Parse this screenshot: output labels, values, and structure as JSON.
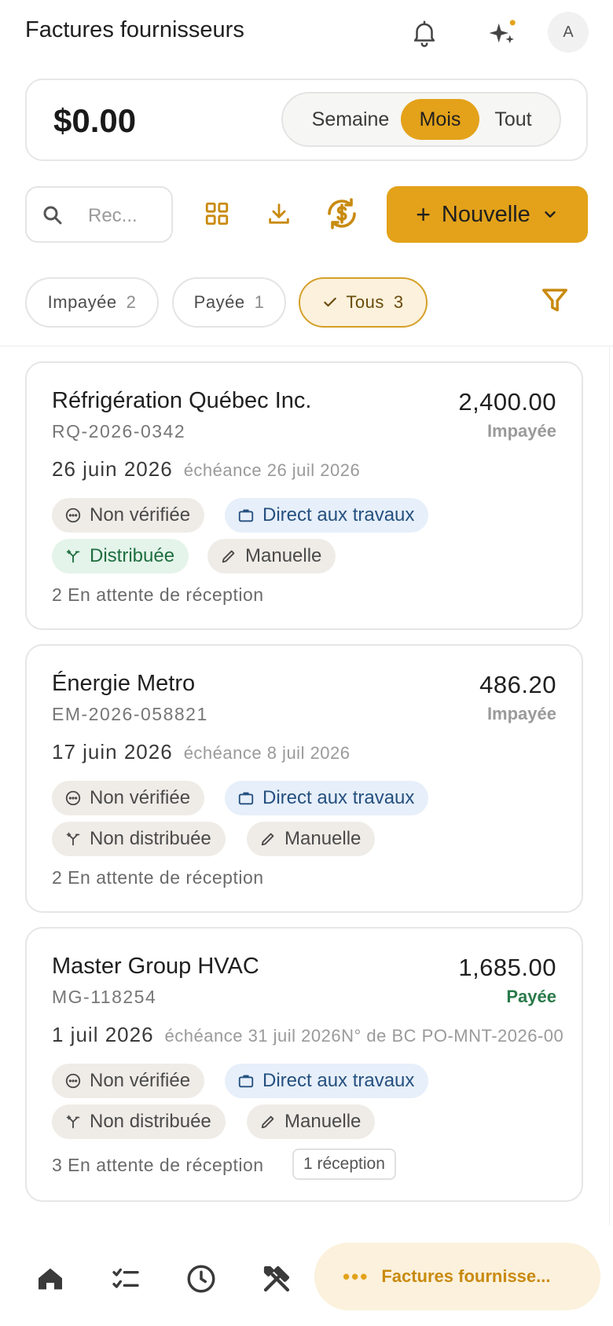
{
  "header": {
    "title": "Factures fournisseurs",
    "notifications_icon": "bell-icon",
    "assistant_icon": "sparkles-icon",
    "avatar_initial": "A"
  },
  "summary": {
    "total": "$0.00",
    "periods": [
      "Semaine",
      "Mois",
      "Tout"
    ],
    "selected_period": "Mois"
  },
  "toolbar": {
    "search_placeholder": "Rec...",
    "new_label": "Nouvelle",
    "icons": [
      "grid-icon",
      "download-icon",
      "currency-sync-icon"
    ]
  },
  "filters": {
    "chips": [
      {
        "label": "Impayée",
        "count": "2"
      },
      {
        "label": "Payée",
        "count": "1"
      },
      {
        "label": "Tous",
        "count": "3"
      }
    ],
    "active": "Tous"
  },
  "invoices": [
    {
      "vendor": "Réfrigération Québec Inc.",
      "number": "RQ-2026-0342",
      "amount": "2,400.00",
      "status": "Impayée",
      "date": "26 juin 2026",
      "due": "échéance 26 juil 2026",
      "po": "",
      "verification": "Non vérifiée",
      "delivery": "Direct aux travaux",
      "distribution": "Distribuée",
      "mode": "Manuelle",
      "pending": "2 En attente de réception",
      "reception": ""
    },
    {
      "vendor": "Énergie Metro",
      "number": "EM-2026-058821",
      "amount": "486.20",
      "status": "Impayée",
      "date": "17 juin 2026",
      "due": "échéance 8 juil 2026",
      "po": "",
      "verification": "Non vérifiée",
      "delivery": "Direct aux travaux",
      "distribution": "Non distribuée",
      "mode": "Manuelle",
      "pending": "2 En attente de réception",
      "reception": ""
    },
    {
      "vendor": "Master Group HVAC",
      "number": "MG-118254",
      "amount": "1,685.00",
      "status": "Payée",
      "date": "1 juil 2026",
      "due": "échéance 31 juil 2026",
      "po": "N° de BC PO-MNT-2026-00",
      "verification": "Non vérifiée",
      "delivery": "Direct aux travaux",
      "distribution": "Non distribuée",
      "mode": "Manuelle",
      "pending": "3 En attente de réception",
      "reception": "1 réception"
    }
  ],
  "bottom_nav": {
    "icons": [
      "home-icon",
      "checklist-icon",
      "clock-icon",
      "tools-icon"
    ],
    "current_label": "Factures fournisse..."
  },
  "colors": {
    "accent": "#e3a21a",
    "accent_soft": "#fbf1dc",
    "paid_green": "#2a7a4a",
    "blue_tag": "#e6effa"
  }
}
